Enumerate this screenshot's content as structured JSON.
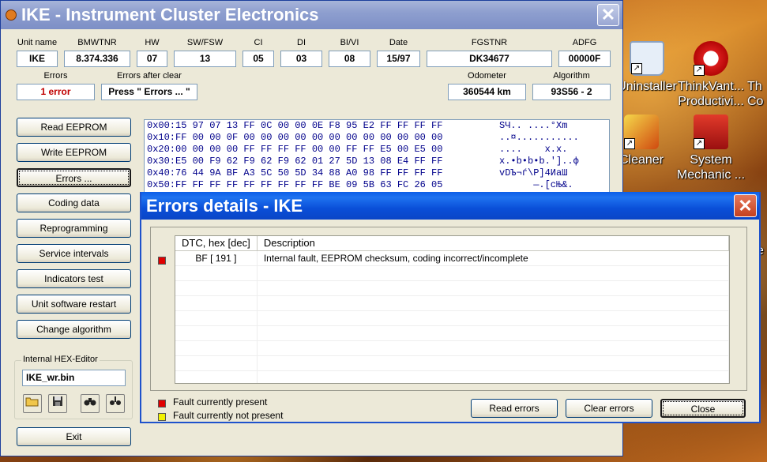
{
  "desktop": {
    "icons": [
      {
        "label_line1": "Uninstaller",
        "label_line2": ""
      },
      {
        "label_line1": "ThinkVant...",
        "label_line2": "Productivi..."
      },
      {
        "label_line1": "Th",
        "label_line2": "Co"
      },
      {
        "label_line1": "Cleaner",
        "label_line2": ""
      },
      {
        "label_line1": "System",
        "label_line2": "Mechanic ..."
      },
      {
        "label_line1": "e",
        "label_line2": ""
      }
    ]
  },
  "main_window": {
    "title": "IKE - Instrument Cluster Electronics",
    "close_glyph": "✕",
    "fields": {
      "unit_name": {
        "label": "Unit name",
        "value": "IKE"
      },
      "bmwtnr": {
        "label": "BMWTNR",
        "value": "8.374.336"
      },
      "hw": {
        "label": "HW",
        "value": "07"
      },
      "sw_fsw": {
        "label": "SW/FSW",
        "value": "13"
      },
      "ci": {
        "label": "CI",
        "value": "05"
      },
      "di": {
        "label": "DI",
        "value": "03"
      },
      "bi_vi": {
        "label": "BI/VI",
        "value": "08"
      },
      "date": {
        "label": "Date",
        "value": "15/97"
      },
      "fgstnr": {
        "label": "FGSTNR",
        "value": "DK34677"
      },
      "adfg": {
        "label": "ADFG",
        "value": "00000F"
      },
      "errors": {
        "label": "Errors",
        "value": "1 error"
      },
      "errors_after_clear": {
        "label": "Errors after clear",
        "value": "Press \" Errors ... \""
      },
      "odometer": {
        "label": "Odometer",
        "value": "360544 km"
      },
      "algorithm": {
        "label": "Algorithm",
        "value": "93S56 - 2"
      }
    },
    "buttons": [
      "Read EEPROM",
      "Write EEPROM",
      "Errors ...",
      "Coding data",
      "Reprogramming",
      "Service intervals",
      "Indicators test",
      "Unit software restart",
      "Change algorithm"
    ],
    "hex_editor": {
      "group_label": "Internal HEX-Editor",
      "filename": "IKE_wr.bin"
    },
    "exit_label": "Exit",
    "hex_rows": [
      {
        "addr": "0x00:",
        "bytes": "15 97 07 13 FF 0C 00 00 0E F8 95 E2 FF FF FF FF",
        "ascii": "SЧ.. ....°Xm"
      },
      {
        "addr": "0x10:",
        "bytes": "FF 00 00 0F 00 00 00 00 00 00 00 00 00 00 00 00",
        "ascii": "..¤..........."
      },
      {
        "addr": "0x20:",
        "bytes": "00 00 00 00 FF FF FF FF 00 00 FF FF E5 00 E5 00",
        "ascii": "....    x.x."
      },
      {
        "addr": "0x30:",
        "bytes": "E5 00 F9 62 F9 62 F9 62 01 27 5D 13 08 E4 FF FF",
        "ascii": "x.•b•b•b.']..ф"
      },
      {
        "addr": "0x40:",
        "bytes": "76 44 9A BF A3 5C 50 5D 34 88 A0 98 FF FF FF FF",
        "ascii": "vDЪ¬ѓ\\P]4ИаШ"
      },
      {
        "addr": "0x50:",
        "bytes": "FF FF FF FF FF FF FF FF FF BE 09 5B 63 FC 26 05",
        "ascii": "      —.[cЊ&."
      }
    ]
  },
  "errors_dialog": {
    "title": "Errors details - IKE",
    "close_glyph": "✕",
    "columns": [
      "DTC, hex [dec]",
      "Description"
    ],
    "rows": [
      {
        "status_color": "#e00000",
        "dtc": "BF [ 191 ]",
        "description": "Internal fault, EEPROM checksum, coding incorrect/incomplete"
      }
    ],
    "legend": [
      {
        "color": "#e00000",
        "label": "Fault currently present"
      },
      {
        "color": "#f2f200",
        "label": "Fault currently not present"
      }
    ],
    "buttons": {
      "read": "Read errors",
      "clear": "Clear errors",
      "close": "Close"
    }
  }
}
